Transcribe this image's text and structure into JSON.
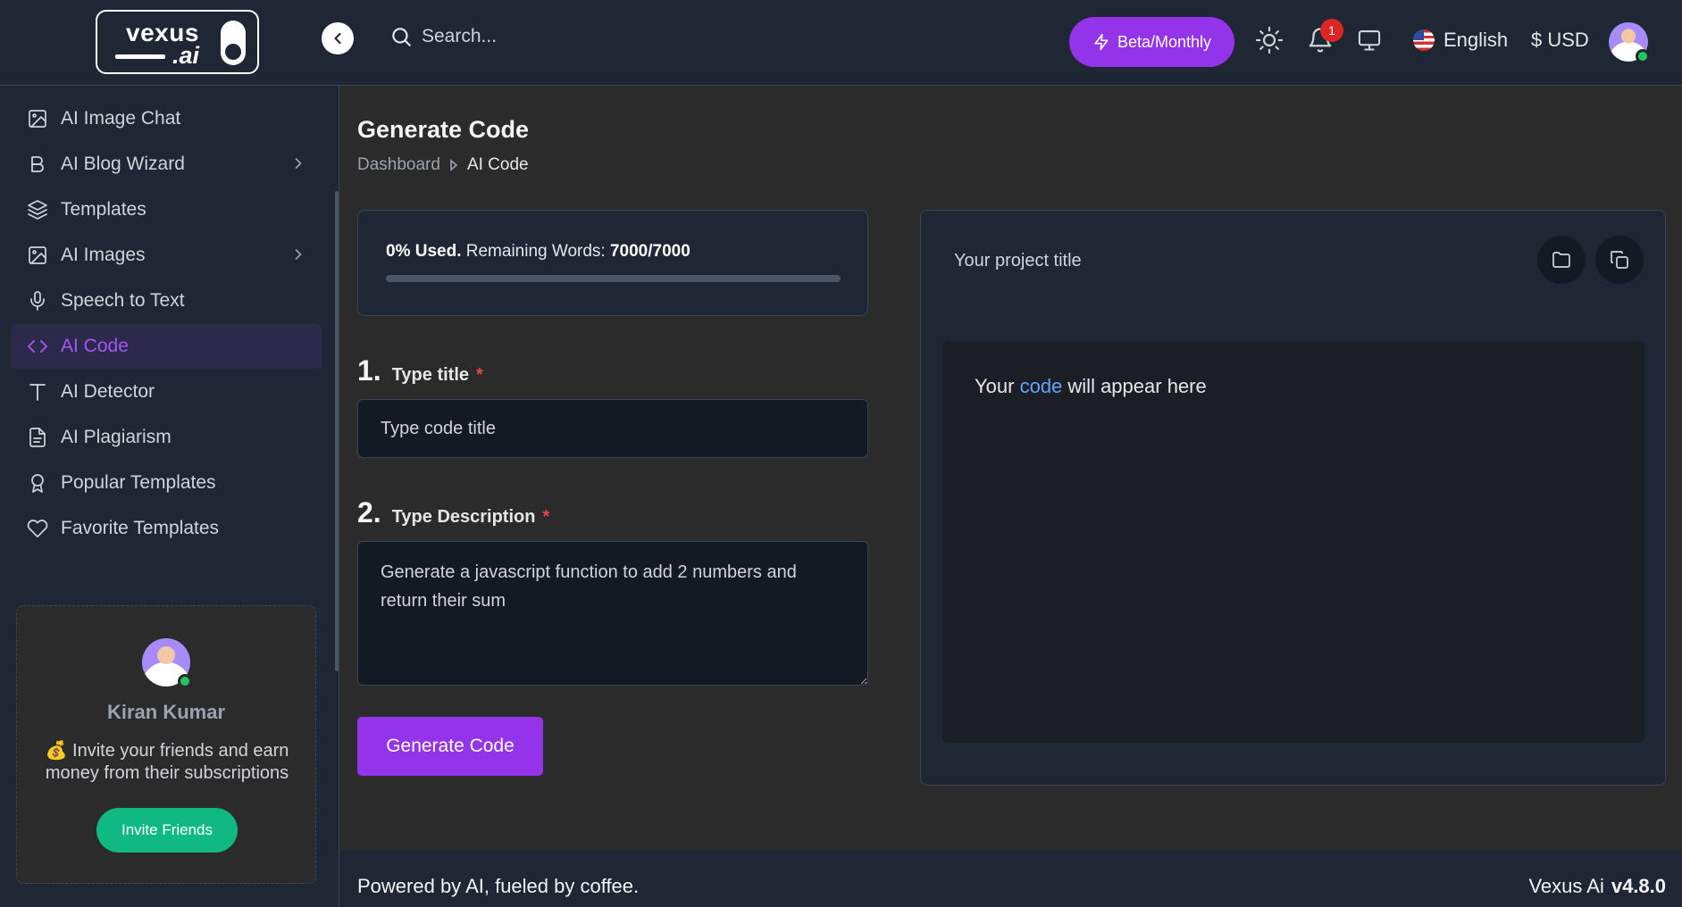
{
  "header": {
    "logo_word": "vexus",
    "logo_suffix": ".ai",
    "search_placeholder": "Search...",
    "plan_button": "Beta/Monthly",
    "notification_count": "1",
    "language": "English",
    "currency": "$ USD"
  },
  "sidebar": {
    "items": [
      {
        "label": "AI Image Chat",
        "icon": "image-icon"
      },
      {
        "label": "AI Blog Wizard",
        "icon": "bold-b-icon",
        "has_submenu": true
      },
      {
        "label": "Templates",
        "icon": "layers-icon"
      },
      {
        "label": "AI Images",
        "icon": "image-icon",
        "has_submenu": true
      },
      {
        "label": "Speech to Text",
        "icon": "microphone-icon"
      },
      {
        "label": "AI Code",
        "icon": "code-icon",
        "active": true
      },
      {
        "label": "AI Detector",
        "icon": "text-t-icon"
      },
      {
        "label": "AI Plagiarism",
        "icon": "file-text-icon"
      },
      {
        "label": "Popular Templates",
        "icon": "award-icon"
      },
      {
        "label": "Favorite Templates",
        "icon": "heart-icon"
      }
    ],
    "referral": {
      "name": "Kiran Kumar",
      "emoji": "💰",
      "text": "Invite your friends and earn money from their subscriptions",
      "button": "Invite Friends"
    }
  },
  "main": {
    "title": "Generate Code",
    "breadcrumb": [
      "Dashboard",
      "AI Code"
    ],
    "usage": {
      "used_label": "0% Used.",
      "remaining_label": "Remaining Words:",
      "remaining_value": "7000/7000",
      "used_fraction": 0
    },
    "step1": {
      "number": "1.",
      "label": "Type title",
      "required_mark": "*",
      "placeholder": "Type code title"
    },
    "step2": {
      "number": "2.",
      "label": "Type Description",
      "required_mark": "*",
      "value": "Generate a javascript function to add 2 numbers and return their sum"
    },
    "generate_button": "Generate Code",
    "output": {
      "project_title": "Your project title",
      "placeholder_before": "Your ",
      "placeholder_highlight": "code",
      "placeholder_after": " will appear here"
    }
  },
  "footer": {
    "tagline": "Powered by AI, fueled by coffee.",
    "brand": "Vexus Ai",
    "version": "v4.8.0"
  },
  "colors": {
    "accent": "#9333ea",
    "success": "#10b981",
    "danger": "#dc2626",
    "panel": "#1e2733"
  }
}
